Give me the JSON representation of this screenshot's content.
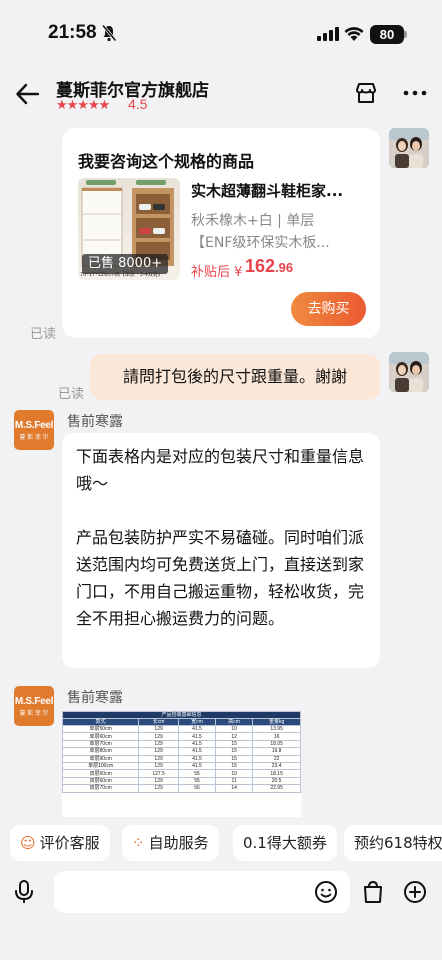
{
  "status_bar": {
    "time": "21:58",
    "battery": "80"
  },
  "header": {
    "store_name": "蔓斯菲尔官方旗舰店",
    "stars": "★★★★★",
    "rating": "4.5"
  },
  "product_card": {
    "title": "我要咨询这个规格的商品",
    "sold": "已售 8000+",
    "dimension_caption": "70*17*126cm高【单层 · 3-4双鞋】",
    "name": "实木超薄翻斗鞋柜家...",
    "spec": "秋禾橡木+白 | 单层",
    "desc": "【ENF级环保实木板...",
    "price_label": "补贴后",
    "price_symbol": "¥",
    "price_int": "162",
    "price_dec": ".96",
    "buy_label": "去购买"
  },
  "read_label": "已读",
  "user_message": "請問打包後的尺寸跟重量。謝謝",
  "agent": {
    "name": "售前寒露",
    "avatar_text": "M.S.Feel",
    "avatar_sub": "蔓 斯 菲 尔",
    "messages": [
      "下面表格内是对应的包装尺寸和重量信息哦～",
      "产品包装防护严实不易磕碰。同时咱们派送范围内均可免费送货上门，直接送到家门口，不用自己搬运重物，轻松收货，完全不用担心搬运费力的问题。"
    ]
  },
  "table": {
    "title": "产品包装基础信息",
    "headers": [
      "款式",
      "长cm",
      "宽cm",
      "高cm",
      "重量kg"
    ],
    "rows": [
      [
        "单层50cm",
        "129",
        "41.5",
        "10",
        "13.95"
      ],
      [
        "单层60cm",
        "129",
        "41.5",
        "12",
        "16"
      ],
      [
        "单层70cm",
        "129",
        "41.5",
        "15",
        "18.05"
      ],
      [
        "单层80cm",
        "129",
        "41.5",
        "15",
        "19.8"
      ],
      [
        "单层90cm",
        "129",
        "41.5",
        "15",
        "22"
      ],
      [
        "单层100cm",
        "129",
        "41.5",
        "15",
        "23.4"
      ],
      [
        "双层50cm",
        "127.5",
        "55",
        "10",
        "18.15"
      ],
      [
        "双层60cm",
        "129",
        "55",
        "11",
        "20.5"
      ],
      [
        "双层70cm",
        "129",
        "56",
        "14",
        "22.95"
      ]
    ]
  },
  "chips": [
    {
      "label": "评价客服",
      "icon": "smile-icon"
    },
    {
      "label": "自助服务",
      "icon": "grid-icon"
    },
    {
      "label": "0.1得大额券",
      "icon": ""
    },
    {
      "label": "预约618特权",
      "icon": ""
    }
  ],
  "colors": {
    "accent": "#e8434a",
    "orange": "#ea5a32",
    "bubble_self": "#fbe7d8"
  }
}
